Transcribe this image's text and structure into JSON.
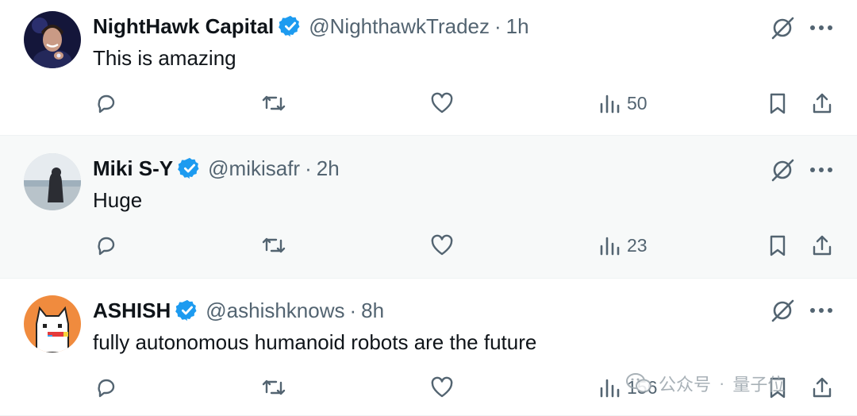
{
  "tweets": [
    {
      "name": "NightHawk Capital",
      "handle": "@NighthawkTradez",
      "separator": "·",
      "time": "1h",
      "text": "This is amazing",
      "views": "50"
    },
    {
      "name": "Miki S-Y",
      "handle": "@mikisafr",
      "separator": "·",
      "time": "2h",
      "text": "Huge",
      "views": "23"
    },
    {
      "name": "ASHISH",
      "handle": "@ashishknows",
      "separator": "·",
      "time": "8h",
      "text": "fully autonomous humanoid robots are the future",
      "views": "156"
    }
  ],
  "watermark": {
    "platform": "公众号",
    "separator": "·",
    "brand": "量子位"
  },
  "colors": {
    "text": "#0f1419",
    "secondary": "#536471",
    "verified": "#1d9bf0",
    "highlight_bg": "#f7f9f9",
    "divider": "#eff3f4"
  },
  "icons": [
    "verified-badge-icon",
    "grok-slash-icon",
    "more-icon",
    "reply-icon",
    "retweet-icon",
    "like-icon",
    "views-icon",
    "bookmark-icon",
    "share-icon"
  ]
}
